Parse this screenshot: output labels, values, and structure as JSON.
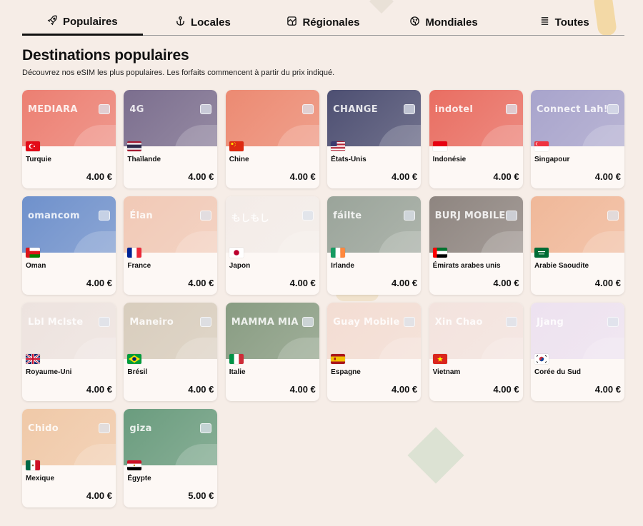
{
  "tabs": [
    {
      "label": "Populaires",
      "icon": "rocket-icon",
      "active": true
    },
    {
      "label": "Locales",
      "icon": "anchor-icon",
      "active": false
    },
    {
      "label": "Régionales",
      "icon": "map-icon",
      "active": false
    },
    {
      "label": "Mondiales",
      "icon": "globe-icon",
      "active": false
    },
    {
      "label": "Toutes",
      "icon": "list-icon",
      "active": false
    }
  ],
  "heading": {
    "title": "Destinations populaires",
    "subtitle": "Découvrez nos eSIM les plus populaires. Les forfaits commencent à partir du prix indiqué."
  },
  "cards": [
    {
      "country": "Turquie",
      "price": "4.00 €",
      "brand": "MEDIARA",
      "bg": "#ec7f72",
      "flag": "tr"
    },
    {
      "country": "Thaïlande",
      "price": "4.00 €",
      "brand": "4G",
      "bg": "#7b6e8e",
      "flag": "th"
    },
    {
      "country": "Chine",
      "price": "4.00 €",
      "brand": "",
      "bg": "#ec8a72",
      "flag": "cn"
    },
    {
      "country": "États-Unis",
      "price": "4.00 €",
      "brand": "CHANGE",
      "bg": "#4d4f72",
      "flag": "us"
    },
    {
      "country": "Indonésie",
      "price": "4.00 €",
      "brand": "indotel",
      "bg": "#e96e62",
      "flag": "id"
    },
    {
      "country": "Singapour",
      "price": "4.00 €",
      "brand": "Connect Lah!",
      "bg": "#a8a4cc",
      "flag": "sg"
    },
    {
      "country": "Oman",
      "price": "4.00 €",
      "brand": "omancom",
      "bg": "#6f91cc",
      "flag": "om"
    },
    {
      "country": "France",
      "price": "4.00 €",
      "brand": "Élan",
      "bg": "#f1c9b6",
      "flag": "fr"
    },
    {
      "country": "Japon",
      "price": "4.00 €",
      "brand": "もしもし",
      "bg": "#f3ece8",
      "flag": "jp"
    },
    {
      "country": "Irlande",
      "price": "4.00 €",
      "brand": "fáilte",
      "bg": "#9aa49a",
      "flag": "ie"
    },
    {
      "country": "Émirats arabes unis",
      "price": "4.00 €",
      "brand": "BURJ MOBILE",
      "bg": "#8e8580",
      "flag": "ae"
    },
    {
      "country": "Arabie Saoudite",
      "price": "4.00 €",
      "brand": "",
      "bg": "#f0b899",
      "flag": "sa"
    },
    {
      "country": "Royaume-Uni",
      "price": "4.00 €",
      "brand": "Lbl Mclste",
      "bg": "#ede3df",
      "flag": "gb"
    },
    {
      "country": "Brésil",
      "price": "4.00 €",
      "brand": "Maneiro",
      "bg": "#d8cdbd",
      "flag": "br"
    },
    {
      "country": "Italie",
      "price": "4.00 €",
      "brand": "MAMMA MIA",
      "bg": "#889c82",
      "flag": "it"
    },
    {
      "country": "Espagne",
      "price": "4.00 €",
      "brand": "Guay Mobile",
      "bg": "#f3ddd3",
      "flag": "es"
    },
    {
      "country": "Vietnam",
      "price": "4.00 €",
      "brand": "Xin Chao",
      "bg": "#f3e3de",
      "flag": "vn"
    },
    {
      "country": "Corée du Sud",
      "price": "4.00 €",
      "brand": "Jjang",
      "bg": "#ede2f0",
      "flag": "kr"
    },
    {
      "country": "Mexique",
      "price": "4.00 €",
      "brand": "Chido",
      "bg": "#f0c9a8",
      "flag": "mx"
    },
    {
      "country": "Égypte",
      "price": "5.00 €",
      "brand": "giza",
      "bg": "#6a9c7e",
      "flag": "eg"
    }
  ]
}
